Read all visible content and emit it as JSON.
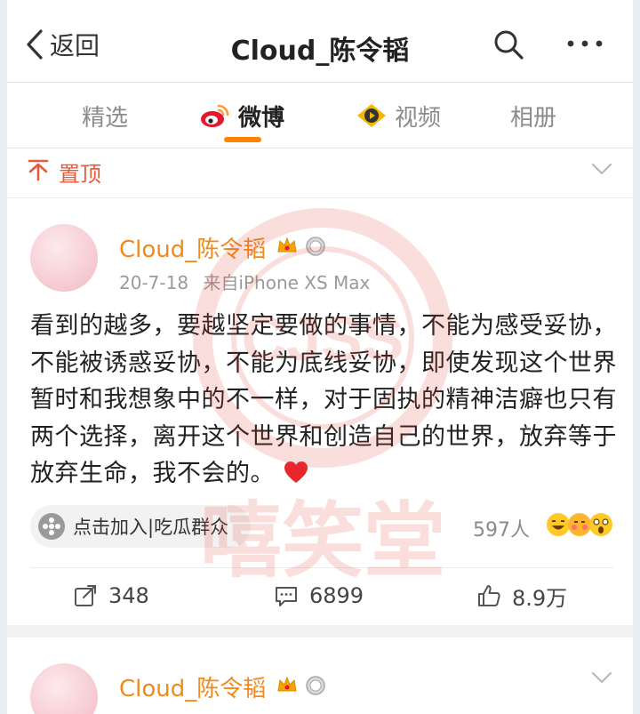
{
  "nav": {
    "back_label": "返回",
    "title": "Cloud_陈令韬",
    "search_icon": "search-icon",
    "more_icon": "more-icon"
  },
  "tabs": [
    {
      "label": "精选",
      "active": false
    },
    {
      "label": "微博",
      "active": true
    },
    {
      "label": "视频",
      "active": false
    },
    {
      "label": "相册",
      "active": false
    }
  ],
  "accent_color": "#ff8200",
  "pinned": {
    "label": "置顶",
    "color": "#e85a3a"
  },
  "post": {
    "username": "Cloud_陈令韬",
    "date": "20-7-18",
    "source": "来自iPhone XS Max",
    "text": "看到的越多，要越坚定要做的事情，不能为感受妥协，不能被诱惑妥协，不能为底线妥协，即使发现这个世界暂时和我想象中的不一样，对于固执的精神洁癖也只有两个选择，离开这个世界和创造自己的世界，放弃等于放弃生命，我不会的。",
    "join_label": "点击加入|吃瓜群众",
    "people_count": "597人",
    "reposts": "348",
    "comments": "6899",
    "likes": "8.9万"
  },
  "post2": {
    "username": "Cloud_陈令韬"
  },
  "watermark": {
    "logo_text": "CJSS",
    "text": "嘻笑堂"
  }
}
